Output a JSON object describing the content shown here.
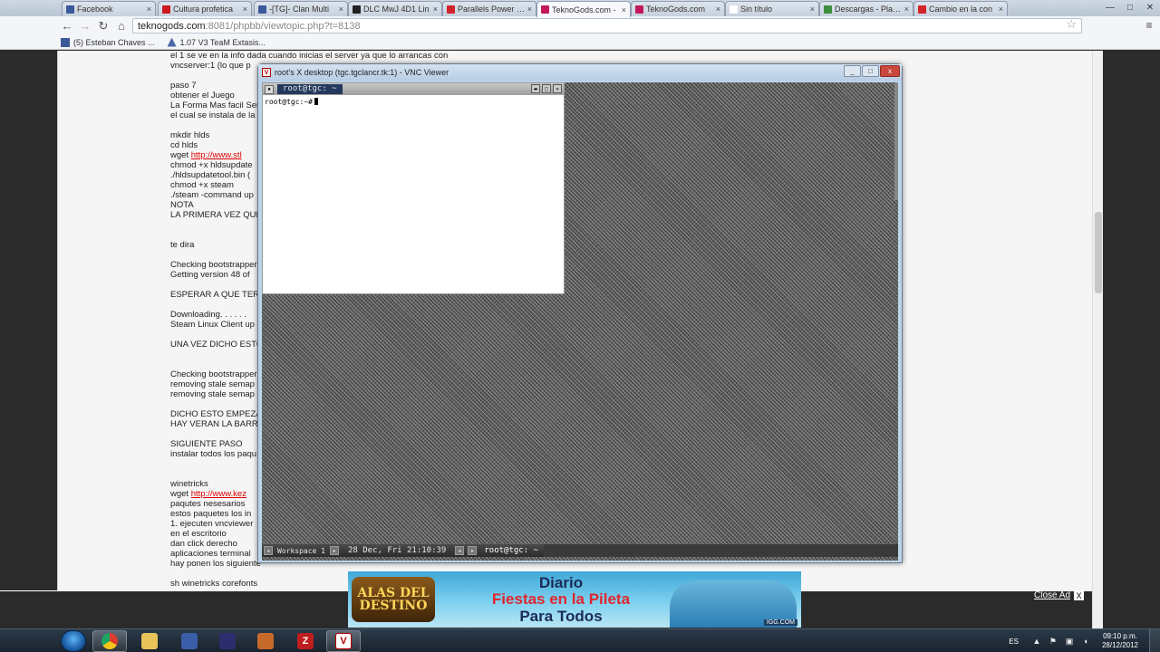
{
  "browser": {
    "tabs": [
      {
        "label": "Facebook",
        "fav": "#3b5998"
      },
      {
        "label": "Cultura profetica",
        "fav": "#cc181e"
      },
      {
        "label": "-[TG]- Clan Multi",
        "fav": "#3b5998"
      },
      {
        "label": "DLC MwJ 4D1 Lin",
        "fav": "#222222"
      },
      {
        "label": "Parallels Power Pa",
        "fav": "#d0232a"
      },
      {
        "label": "TeknoGods.com -",
        "fav": "#c2185b"
      },
      {
        "label": "TeknoGods.com",
        "fav": "#c2185b"
      },
      {
        "label": "Sin título",
        "fav": "#ffffff"
      },
      {
        "label": "Descargas - PlayO",
        "fav": "#3d8f3d"
      },
      {
        "label": "Cambio en la con",
        "fav": "#d0232a"
      }
    ],
    "tab_close_glyph": "×",
    "window_controls": {
      "minimize": "—",
      "maximize": "□",
      "close": "✕"
    },
    "nav": {
      "back": "←",
      "forward": "→",
      "reload": "↻",
      "home": "⌂"
    },
    "address": {
      "host": "teknogods.com",
      "path": ":8081/phpbb/viewtopic.php?t=8138"
    },
    "star": "☆",
    "menu": "≡",
    "bookmarks": [
      {
        "label": "(5) Esteban Chaves ...",
        "icon": "facebook-icon"
      },
      {
        "label": "1.07 V3 TeaM Extasis...",
        "icon": "bookmark-icon"
      }
    ]
  },
  "post_lines": [
    {
      "text": "el 1 se ve en la info dada cuando inicias el server ya que lo arrancas con"
    },
    {
      "text": "vncserver:1 (lo que p"
    },
    {
      "text": ""
    },
    {
      "text": "paso 7"
    },
    {
      "text": "obtener el Juego"
    },
    {
      "text": "La Forma Mas facil Ser"
    },
    {
      "text": "el cual se instala de la"
    },
    {
      "text": ""
    },
    {
      "text": "mkdir hlds"
    },
    {
      "text": "cd hlds"
    },
    {
      "text": "wget ",
      "link": "http://www.stl"
    },
    {
      "text": "chmod +x hldsupdate"
    },
    {
      "text": "./hldsupdatetool.bin ("
    },
    {
      "text": "chmod +x steam"
    },
    {
      "text": "./steam -command up"
    },
    {
      "text": "NOTA"
    },
    {
      "text": "LA PRIMERA VEZ QUE"
    },
    {
      "text": ""
    },
    {
      "text": ""
    },
    {
      "text": "te dira"
    },
    {
      "text": ""
    },
    {
      "text": "Checking bootstrapper"
    },
    {
      "text": "Getting version 48 of"
    },
    {
      "text": ""
    },
    {
      "text": "ESPERAR A QUE TERM"
    },
    {
      "text": ""
    },
    {
      "text": "Downloading. . . . . ."
    },
    {
      "text": "Steam Linux Client up"
    },
    {
      "text": ""
    },
    {
      "text": "UNA VEZ DICHO ESTO"
    },
    {
      "text": ""
    },
    {
      "text": ""
    },
    {
      "text": "Checking bootstrapper"
    },
    {
      "text": "removing stale semap"
    },
    {
      "text": "removing stale semap"
    },
    {
      "text": ""
    },
    {
      "text": "DICHO ESTO EMPEZAR"
    },
    {
      "text": "HAY VERAN LA BARRA"
    },
    {
      "text": ""
    },
    {
      "text": "SIGUIENTE PASO"
    },
    {
      "text": "instalar todos los paqu"
    },
    {
      "text": ""
    },
    {
      "text": ""
    },
    {
      "text": "winetricks"
    },
    {
      "text": "wget ",
      "link": "http://www.kez"
    },
    {
      "text": "paqutes nesesarios"
    },
    {
      "text": "estos paquetes los in"
    },
    {
      "text": "1. ejecuten vncviewer"
    },
    {
      "text": "en el escritorio"
    },
    {
      "text": "dan click derecho"
    },
    {
      "text": "aplicaciones terminal"
    },
    {
      "text": "hay ponen los siguiente"
    },
    {
      "text": ""
    },
    {
      "text": "sh winetricks corefonts"
    }
  ],
  "vnc": {
    "title": "root's X desktop (tgc.tgclancr.tk:1) - VNC Viewer",
    "icon_letter": "V",
    "controls": {
      "minimize": "_",
      "maximize": "□",
      "close": "x"
    },
    "xterm": {
      "title": "root@tgc: ~",
      "prompt": "root@tgc:~#",
      "menu_glyph": "▪",
      "buttons": [
        "▬",
        "□",
        "✕"
      ]
    },
    "panel": {
      "workspace": "Workspace 1",
      "clock": "28 Dec, Fri 21:10:39",
      "task": "root@tgc: ~",
      "prev": "◂",
      "next": "▸"
    }
  },
  "ad": {
    "logo": "ALAS DEL DESTINO",
    "line1": "Diario",
    "line2": "Fiestas en la Pileta",
    "line3": "Para Todos",
    "site": "IGG.COM",
    "close_label": "Close Ad",
    "close_glyph": "X"
  },
  "taskbar": {
    "apps": [
      {
        "name": "chrome",
        "glyph": "",
        "color": "#dd3b2f",
        "active": true
      },
      {
        "name": "explorer",
        "glyph": "",
        "color": "#e8c35a",
        "active": false
      },
      {
        "name": "putty",
        "glyph": "",
        "color": "#3a5ea8",
        "active": false
      },
      {
        "name": "flag-app",
        "glyph": "",
        "color": "#2d2d6e",
        "active": false
      },
      {
        "name": "game",
        "glyph": "",
        "color": "#c66a2a",
        "active": false
      },
      {
        "name": "filezilla",
        "glyph": "Z",
        "color": "#bf1e1e",
        "active": false
      },
      {
        "name": "vnc-viewer",
        "glyph": "V",
        "color": "#ffffff",
        "active": true
      }
    ],
    "lang": "ES",
    "tray_icons": [
      "▲",
      "⚑",
      "▣",
      "◖"
    ],
    "time": "09:10 p.m.",
    "date": "28/12/2012"
  }
}
